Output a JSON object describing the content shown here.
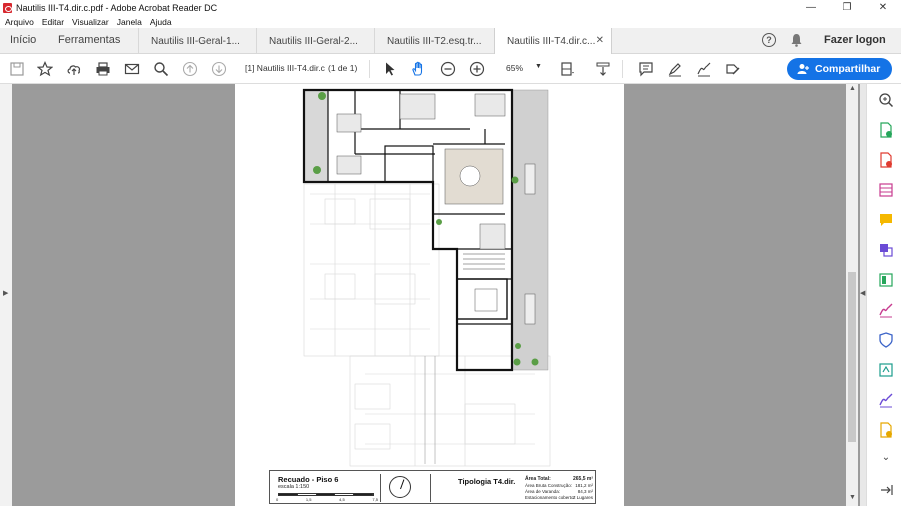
{
  "window": {
    "title": "Nautilis III-T4.dir.c.pdf - Adobe Acrobat Reader DC",
    "controls": {
      "minimize": "—",
      "maximize": "❐",
      "close": "✕"
    }
  },
  "menu": [
    "Arquivo",
    "Editar",
    "Visualizar",
    "Janela",
    "Ajuda"
  ],
  "tabs": {
    "home": "Início",
    "tools": "Ferramentas",
    "documents": [
      {
        "label": "Nautilis III-Geral-1...",
        "close": ""
      },
      {
        "label": "Nautilis III-Geral-2...",
        "close": ""
      },
      {
        "label": "Nautilis III-T2.esq.tr...",
        "close": ""
      },
      {
        "label": "Nautilis III-T4.dir.c...",
        "close": "✕"
      }
    ],
    "active_index": 3,
    "sign_in": "Fazer logon"
  },
  "toolbar": {
    "page_label": "[1] Nautilis III-T4.dir.c",
    "page_count": "(1 de 1)",
    "zoom": "65%",
    "share_label": "Compartilhar",
    "icons": [
      "save-icon",
      "star-icon",
      "cloud-upload-icon",
      "print-icon",
      "mail-icon",
      "search-icon",
      "page-up-icon",
      "page-down-icon",
      "select-cursor-icon",
      "hand-tool-icon",
      "zoom-out-icon",
      "zoom-in-icon",
      "fit-page-icon",
      "scroll-mode-icon",
      "comment-icon",
      "highlight-icon",
      "sign-icon",
      "fill-sign-icon"
    ]
  },
  "right_tools": [
    "zoom-icon",
    "export-pdf-icon",
    "create-pdf-icon",
    "edit-pdf-icon",
    "comment-tool-icon",
    "combine-files-icon",
    "organize-pages-icon",
    "fill-sign-tool-icon",
    "protect-icon",
    "optimize-icon",
    "send-for-signature-icon",
    "more-tools-icon",
    "expand-icon",
    "collapse-panel-icon"
  ],
  "drawing": {
    "title": "Recuado - Piso 6",
    "scale": "escala 1:150",
    "scale_marks": [
      "0",
      "1,5",
      "4,5",
      "7,5"
    ],
    "typology": "Tipologia T4.dir.",
    "areas": [
      {
        "label": "Área Total:",
        "value": "265,5 m²"
      },
      {
        "label": "Área Bruta Construção:",
        "value": "181,2 m²"
      },
      {
        "label": "Área de Varanda:",
        "value": "84,3 m²"
      },
      {
        "label": "Estacionamento coberto:",
        "value": "2 Lugares"
      }
    ]
  },
  "colors": {
    "accent": "#1473e6",
    "canvas": "#9b9b9b",
    "tab_bg": "#f0f0f0"
  }
}
